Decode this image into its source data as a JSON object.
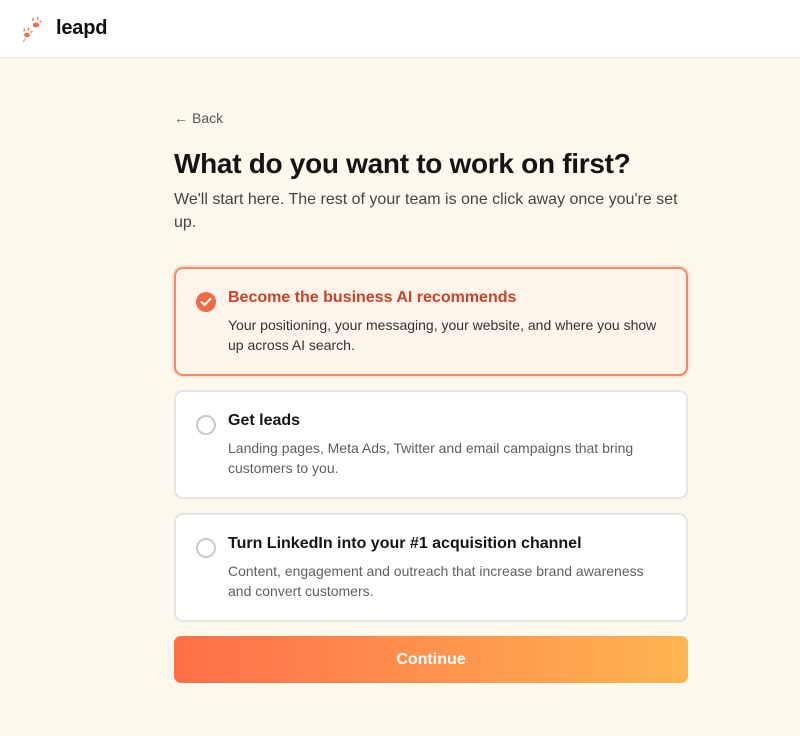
{
  "brand": {
    "name": "leapd",
    "accent": "#f06a4a"
  },
  "nav": {
    "back_label": "Back"
  },
  "page": {
    "title": "What do you want to work on first?",
    "subtitle": "We'll start here. The rest of your team is one click away once you're set up."
  },
  "options": [
    {
      "title": "Become the business AI recommends",
      "description": "Your positioning, your messaging, your website, and where you show up across AI search.",
      "selected": true
    },
    {
      "title": "Get leads",
      "description": "Landing pages, Meta Ads, Twitter and email campaigns that bring customers to you.",
      "selected": false
    },
    {
      "title": "Turn LinkedIn into your #1 acquisition channel",
      "description": "Content, engagement and outreach that increase brand awareness and convert customers.",
      "selected": false
    }
  ],
  "actions": {
    "continue_label": "Continue"
  }
}
